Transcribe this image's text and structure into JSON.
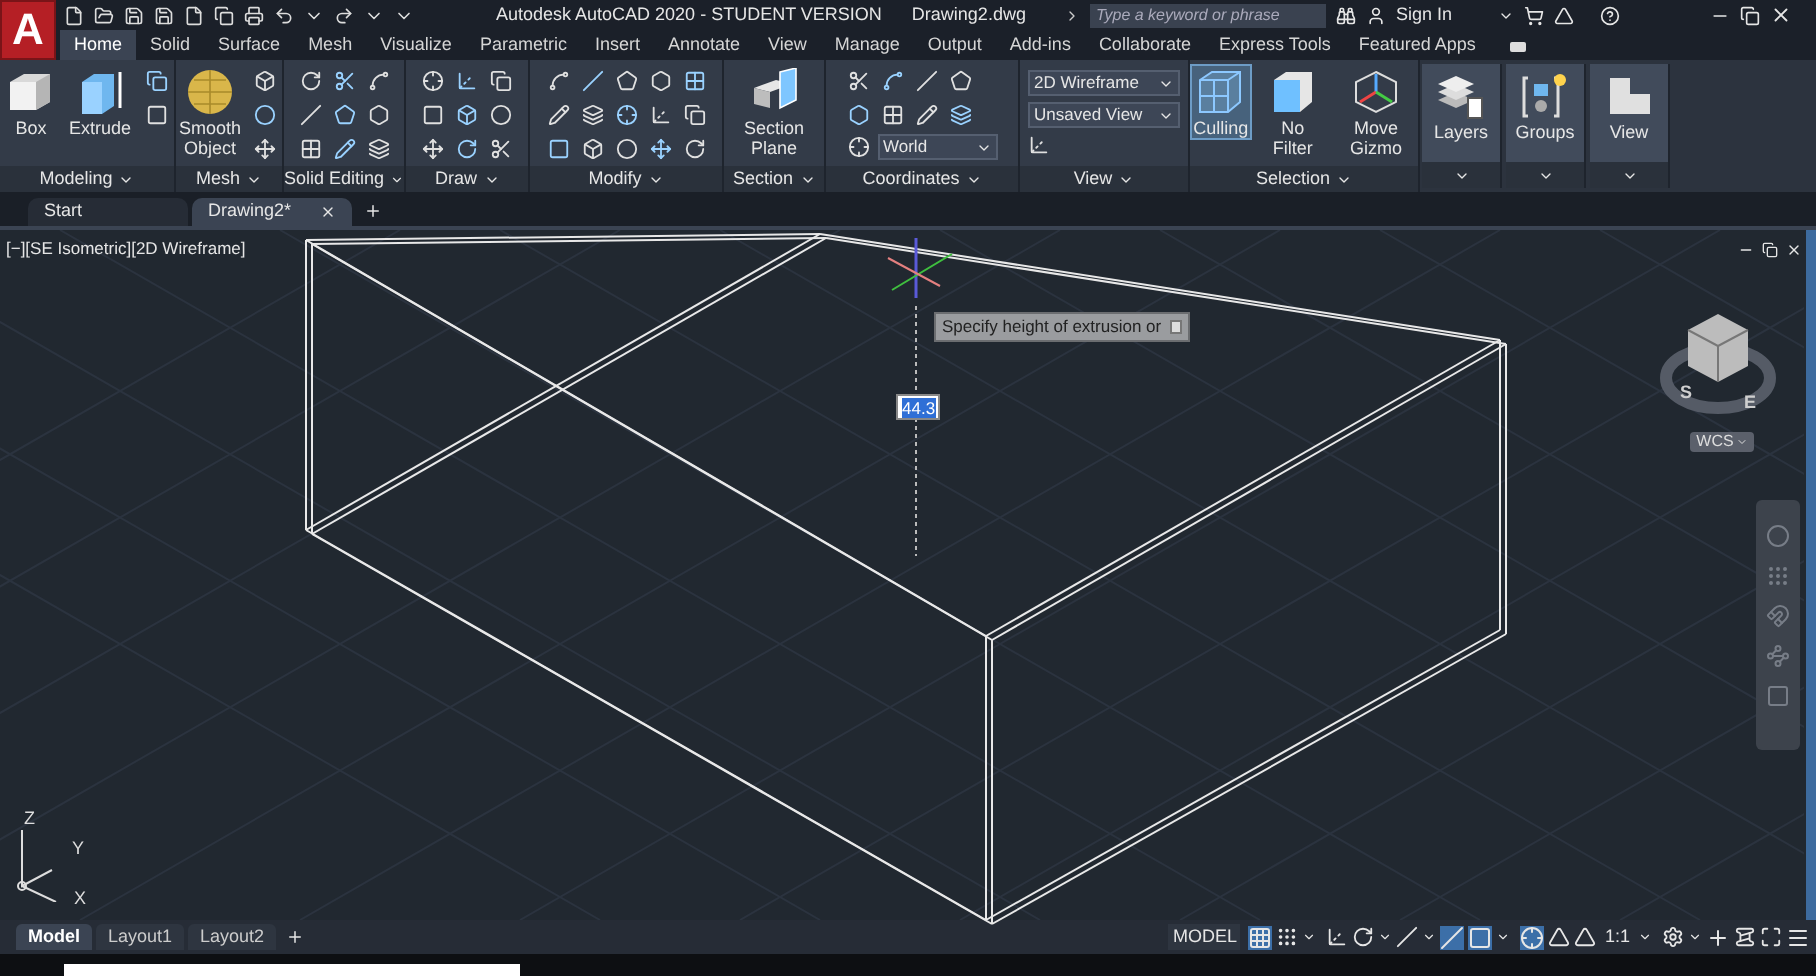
{
  "app_button": {
    "label": "A"
  },
  "title": "Autodesk AutoCAD 2020 - STUDENT VERSION",
  "document": "Drawing2.dwg",
  "search": {
    "placeholder": "Type a keyword or phrase"
  },
  "sign_in": "Sign In",
  "ribbon_tabs": [
    {
      "label": "Home",
      "selected": true
    },
    {
      "label": "Solid",
      "selected": false
    },
    {
      "label": "Surface",
      "selected": false
    },
    {
      "label": "Mesh",
      "selected": false
    },
    {
      "label": "Visualize",
      "selected": false
    },
    {
      "label": "Parametric",
      "selected": false
    },
    {
      "label": "Insert",
      "selected": false
    },
    {
      "label": "Annotate",
      "selected": false
    },
    {
      "label": "View",
      "selected": false
    },
    {
      "label": "Manage",
      "selected": false
    },
    {
      "label": "Output",
      "selected": false
    },
    {
      "label": "Add-ins",
      "selected": false
    },
    {
      "label": "Collaborate",
      "selected": false
    },
    {
      "label": "Express Tools",
      "selected": false
    },
    {
      "label": "Featured Apps",
      "selected": false
    }
  ],
  "panels": [
    {
      "kind": "full",
      "label": "Modeling",
      "large": [
        {
          "label": "Box",
          "selected": false
        },
        {
          "label": "Extrude",
          "selected": false
        }
      ]
    },
    {
      "kind": "full",
      "label": "Mesh",
      "large": [
        {
          "label": "Smooth Object",
          "selected": false
        }
      ]
    },
    {
      "kind": "full",
      "label": "Solid Editing"
    },
    {
      "kind": "full",
      "label": "Draw"
    },
    {
      "kind": "full",
      "label": "Modify"
    },
    {
      "kind": "full",
      "label": "Section",
      "large": [
        {
          "label": "Section Plane",
          "selected": false
        }
      ]
    },
    {
      "kind": "full",
      "label": "Coordinates",
      "dropdowns": [
        "World"
      ]
    },
    {
      "kind": "full",
      "label": "View",
      "dropdowns": [
        "2D Wireframe",
        "Unsaved View"
      ]
    },
    {
      "kind": "full",
      "label": "Selection",
      "large": [
        {
          "label": "Culling",
          "selected": true
        },
        {
          "label": "No Filter",
          "selected": false
        },
        {
          "label": "Move Gizmo",
          "selected": false
        }
      ]
    },
    {
      "kind": "collapsed",
      "large": [
        {
          "label": "Layers",
          "selected": false
        }
      ]
    },
    {
      "kind": "collapsed",
      "large": [
        {
          "label": "Groups",
          "selected": false
        }
      ]
    },
    {
      "kind": "collapsed",
      "large": [
        {
          "label": "View",
          "selected": false
        }
      ]
    }
  ],
  "file_tabs": [
    {
      "label": "Start",
      "selected": false
    },
    {
      "label": "Drawing2*",
      "selected": true
    }
  ],
  "viewport": {
    "label": "[−][SE Isometric][2D Wireframe]",
    "tooltip": "Specify height of extrusion or",
    "input": "44.3",
    "compass": [
      "S",
      "E"
    ],
    "wcs": "WCS",
    "axes": [
      "Z",
      "Y",
      "X"
    ]
  },
  "layout_tabs": [
    {
      "label": "Model",
      "selected": true
    },
    {
      "label": "Layout1",
      "selected": false
    },
    {
      "label": "Layout2",
      "selected": false
    }
  ],
  "status_bar": {
    "mode": "MODEL",
    "scale": "1:1"
  }
}
